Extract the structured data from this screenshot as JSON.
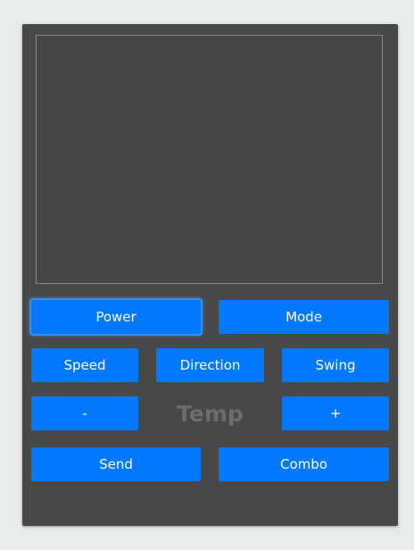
{
  "remote": {
    "buttons": {
      "power": "Power",
      "mode": "Mode",
      "speed": "Speed",
      "direction": "Direction",
      "swing": "Swing",
      "minus": "-",
      "plus": "+",
      "send": "Send",
      "combo": "Combo"
    },
    "temp_label": "Temp"
  },
  "colors": {
    "button": "#0078ff",
    "panel": "#484848",
    "page_background": "#e9eaea"
  }
}
